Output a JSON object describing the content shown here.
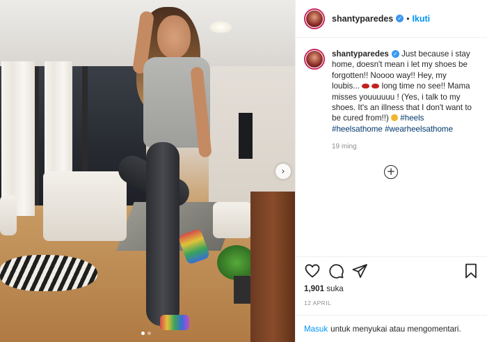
{
  "account": {
    "username": "shantyparedes",
    "verified_icon": "verified-badge-icon",
    "separator": "•",
    "follow_label": "Ikuti"
  },
  "photo": {
    "carousel_total": 2,
    "carousel_current": 1,
    "next_icon": "chevron-right-icon"
  },
  "caption": {
    "username": "shantyparedes",
    "text_1": " Just because i stay home, doesn't mean i let my shoes be forgotten!! Noooo way!! Hey, my loubis... ",
    "text_2": " long time no see!! Mama misses youuuuuu ! (Yes, i talk to my shoes. It's an illness that I don't want to be cured from!!) ",
    "hashtags": [
      "#heels",
      "#heelsathome",
      "#wearheelsathome"
    ],
    "emoji_icons": [
      "lips-icon",
      "lips-icon",
      "grinning-face-icon"
    ],
    "time_ago": "19 ming"
  },
  "comments": {
    "load_more_icon": "plus-circle-icon"
  },
  "actions": {
    "icons": [
      "heart-icon",
      "comment-icon",
      "share-icon",
      "bookmark-icon"
    ],
    "likes_count": "1,901",
    "likes_label": "suka",
    "post_date": "12 APRIL"
  },
  "login_prompt": {
    "link": "Masuk",
    "text": "untuk menyukai atau mengomentari."
  },
  "colors": {
    "link_blue": "#0095f6",
    "hashtag": "#00376b",
    "verified": "#3897f0",
    "muted_text": "#8e8e8e"
  }
}
